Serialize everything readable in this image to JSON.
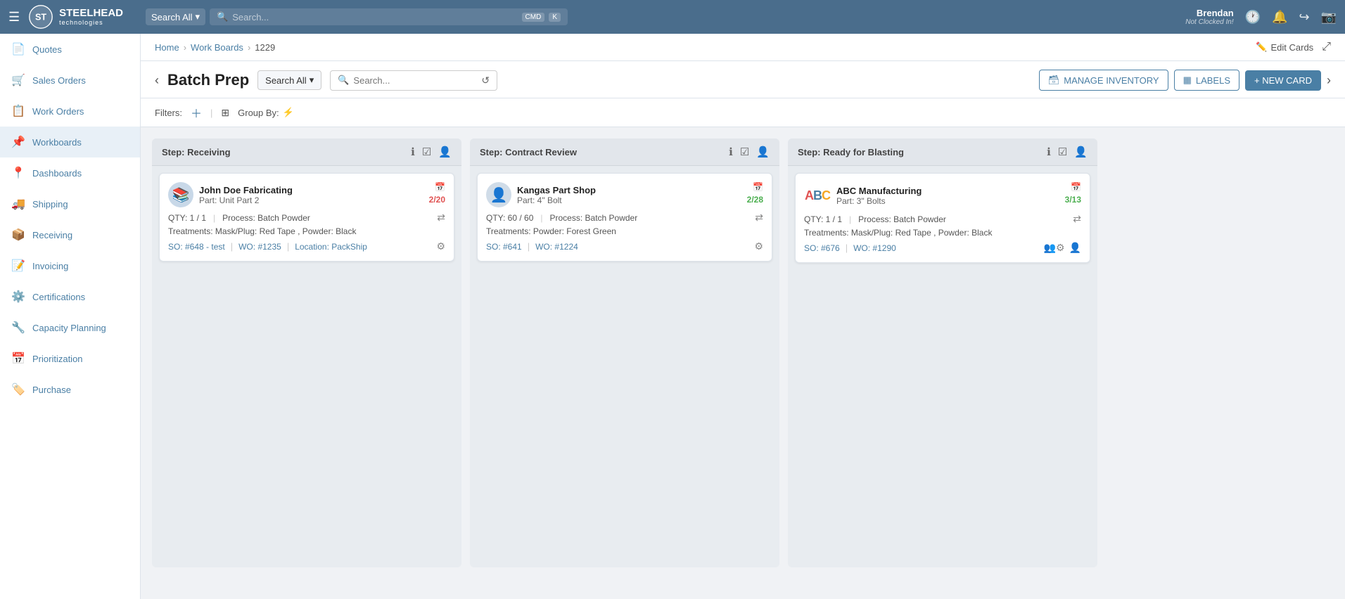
{
  "app": {
    "title": "Steelhead Technologies"
  },
  "topnav": {
    "search_dropdown_label": "Search All",
    "search_placeholder": "Search...",
    "kbd1": "CMD",
    "kbd2": "K",
    "user_name": "Brendan",
    "user_status": "Not Clocked In!"
  },
  "sidebar": {
    "items": [
      {
        "id": "quotes",
        "label": "Quotes",
        "icon": "📄"
      },
      {
        "id": "sales-orders",
        "label": "Sales Orders",
        "icon": "🛒"
      },
      {
        "id": "work-orders",
        "label": "Work Orders",
        "icon": "📋"
      },
      {
        "id": "workboards",
        "label": "Workboards",
        "icon": "📌"
      },
      {
        "id": "dashboards",
        "label": "Dashboards",
        "icon": "📍"
      },
      {
        "id": "shipping",
        "label": "Shipping",
        "icon": "🚚"
      },
      {
        "id": "receiving",
        "label": "Receiving",
        "icon": "📦"
      },
      {
        "id": "invoicing",
        "label": "Invoicing",
        "icon": "📝"
      },
      {
        "id": "certifications",
        "label": "Certifications",
        "icon": "⚙️"
      },
      {
        "id": "capacity-planning",
        "label": "Capacity Planning",
        "icon": "🔧"
      },
      {
        "id": "prioritization",
        "label": "Prioritization",
        "icon": "📅"
      },
      {
        "id": "purchase",
        "label": "Purchase",
        "icon": "🏷️"
      }
    ]
  },
  "breadcrumb": {
    "home": "Home",
    "work_boards": "Work Boards",
    "current": "1229",
    "edit_cards": "Edit Cards"
  },
  "board": {
    "title": "Batch Prep",
    "search_all_label": "Search All",
    "search_placeholder": "Search...",
    "manage_inventory": "MANAGE INVENTORY",
    "labels": "LABELS",
    "new_card": "+ NEW CARD",
    "filters_label": "Filters:",
    "group_by_label": "Group By:"
  },
  "columns": [
    {
      "id": "receiving",
      "title": "Step: Receiving",
      "cards": [
        {
          "customer_name": "John Doe Fabricating",
          "part": "Part: Unit Part 2",
          "date": "2/20",
          "date_color": "red",
          "qty": "QTY: 1 / 1",
          "process": "Process: Batch Powder",
          "treatments": "Treatments: Mask/Plug: Red Tape , Powder: Black",
          "so": "SO: #648 - test",
          "wo": "WO: #1235",
          "location": "Location: PackShip",
          "has_avatar": false,
          "avatar_type": "stack"
        }
      ]
    },
    {
      "id": "contract-review",
      "title": "Step: Contract Review",
      "cards": [
        {
          "customer_name": "Kangas Part Shop",
          "part": "Part: 4\" Bolt",
          "date": "2/28",
          "date_color": "green",
          "qty": "QTY: 60 / 60",
          "process": "Process: Batch Powder",
          "treatments": "Treatments: Powder: Forest Green",
          "so": "SO: #641",
          "wo": "WO: #1224",
          "location": "",
          "has_avatar": true,
          "avatar_type": "person"
        }
      ]
    },
    {
      "id": "ready-for-blasting",
      "title": "Step: Ready for Blasting",
      "cards": [
        {
          "customer_name": "ABC Manufacturing",
          "part": "Part: 3\" Bolts",
          "date": "3/13",
          "date_color": "green",
          "qty": "QTY: 1 / 1",
          "process": "Process: Batch Powder",
          "treatments": "Treatments: Mask/Plug: Red Tape , Powder: Black",
          "so": "SO: #676",
          "wo": "WO: #1290",
          "location": "",
          "has_avatar": false,
          "avatar_type": "abc"
        }
      ]
    }
  ]
}
